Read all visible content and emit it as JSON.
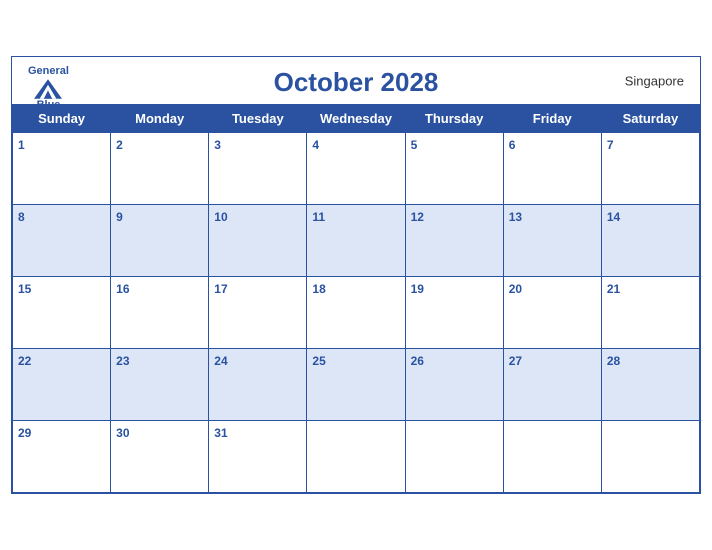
{
  "header": {
    "logo": {
      "general": "General",
      "blue": "Blue"
    },
    "title": "October 2028",
    "region": "Singapore"
  },
  "weekdays": [
    "Sunday",
    "Monday",
    "Tuesday",
    "Wednesday",
    "Thursday",
    "Friday",
    "Saturday"
  ],
  "weeks": [
    [
      1,
      2,
      3,
      4,
      5,
      6,
      7
    ],
    [
      8,
      9,
      10,
      11,
      12,
      13,
      14
    ],
    [
      15,
      16,
      17,
      18,
      19,
      20,
      21
    ],
    [
      22,
      23,
      24,
      25,
      26,
      27,
      28
    ],
    [
      29,
      30,
      31,
      null,
      null,
      null,
      null
    ]
  ]
}
